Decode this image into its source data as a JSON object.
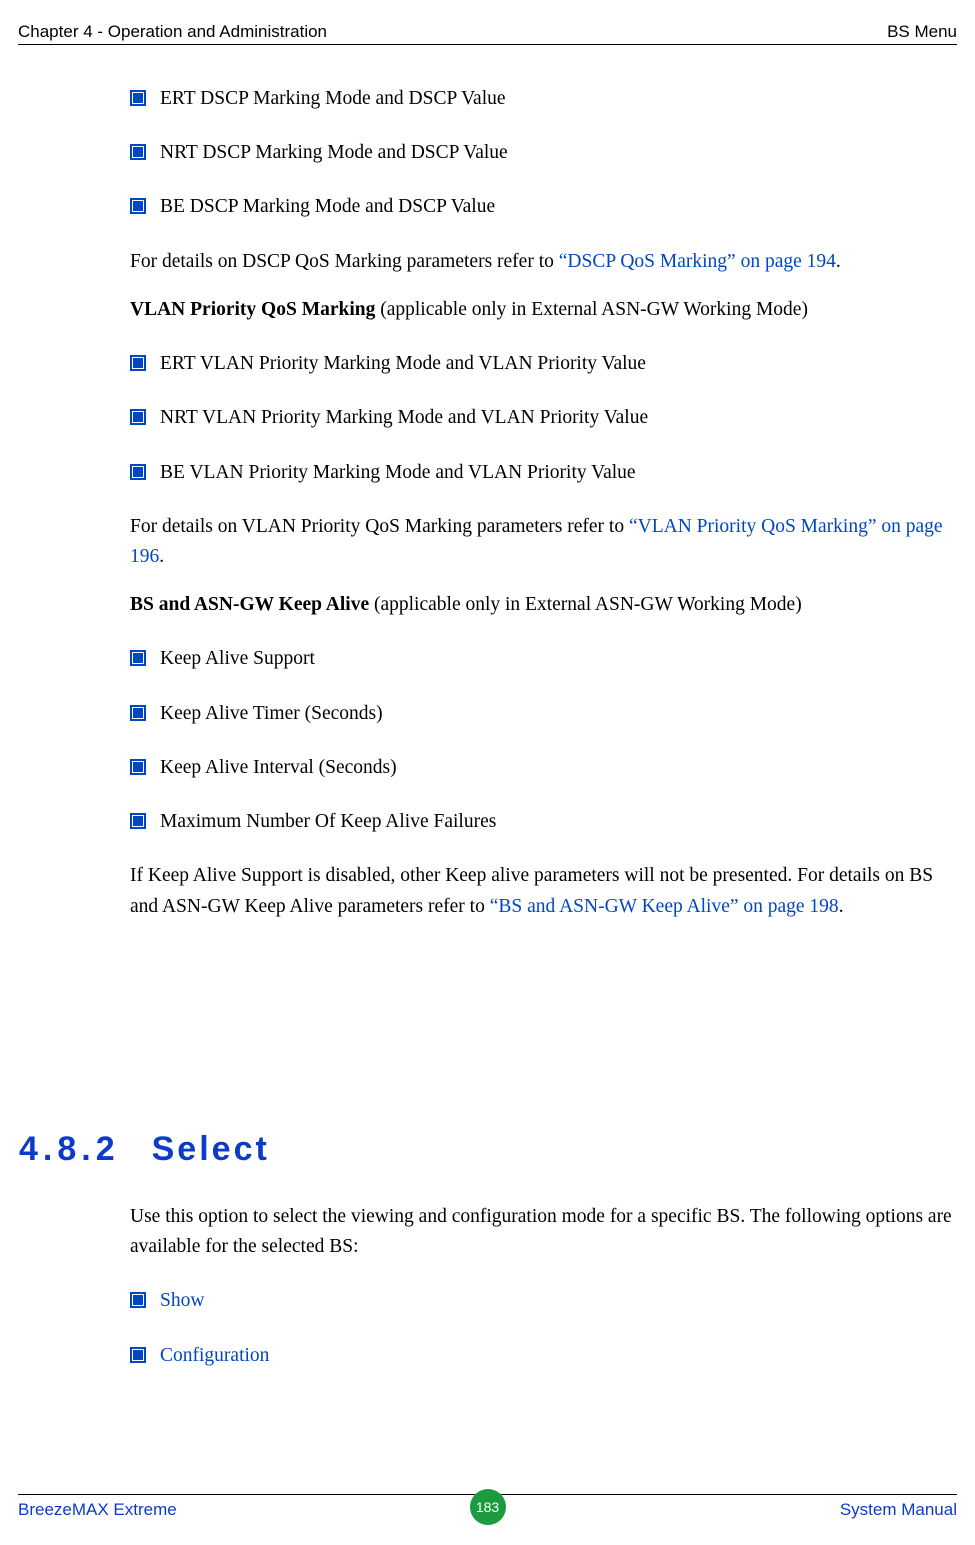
{
  "header": {
    "left": "Chapter 4 - Operation and Administration",
    "right": "BS Menu"
  },
  "dscp": {
    "items": [
      "ERT DSCP Marking Mode and DSCP Value",
      "NRT DSCP Marking Mode and DSCP Value",
      "BE DSCP Marking Mode and DSCP Value"
    ],
    "intro_pre": "For details on DSCP QoS Marking parameters refer to ",
    "intro_link": "“DSCP QoS Marking” on page 194",
    "intro_post": "."
  },
  "vlan": {
    "heading_bold": "VLAN Priority QoS Marking",
    "heading_rest": " (applicable only in External ASN-GW Working Mode)",
    "items": [
      "ERT VLAN Priority Marking Mode and VLAN Priority Value",
      "NRT VLAN Priority Marking Mode and VLAN Priority Value",
      "BE VLAN Priority Marking Mode and VLAN Priority Value"
    ],
    "outro_pre": "For details on VLAN Priority QoS Marking parameters refer to ",
    "outro_link": "“VLAN Priority QoS Marking” on page 196",
    "outro_post": "."
  },
  "keepalive": {
    "heading_bold": "BS and ASN-GW Keep Alive",
    "heading_rest": " (applicable only in External ASN-GW Working Mode)",
    "items": [
      "Keep Alive Support",
      "Keep Alive Timer (Seconds)",
      "Keep Alive Interval (Seconds)",
      "Maximum Number Of Keep Alive Failures"
    ],
    "outro_pre": "If Keep Alive Support is disabled, other Keep alive parameters will not be presented. For details on BS and ASN-GW Keep Alive parameters refer to ",
    "outro_link": "“BS and ASN-GW Keep Alive” on page 198",
    "outro_post": "."
  },
  "section": {
    "number": "4.8.2",
    "title": "Select",
    "intro": "Use this option to select the viewing and configuration mode for a specific BS. The following options are available for the selected BS:",
    "links": [
      "Show",
      "Configuration"
    ]
  },
  "footer": {
    "left": "BreezeMAX Extreme",
    "page": "183",
    "right": "System Manual"
  }
}
